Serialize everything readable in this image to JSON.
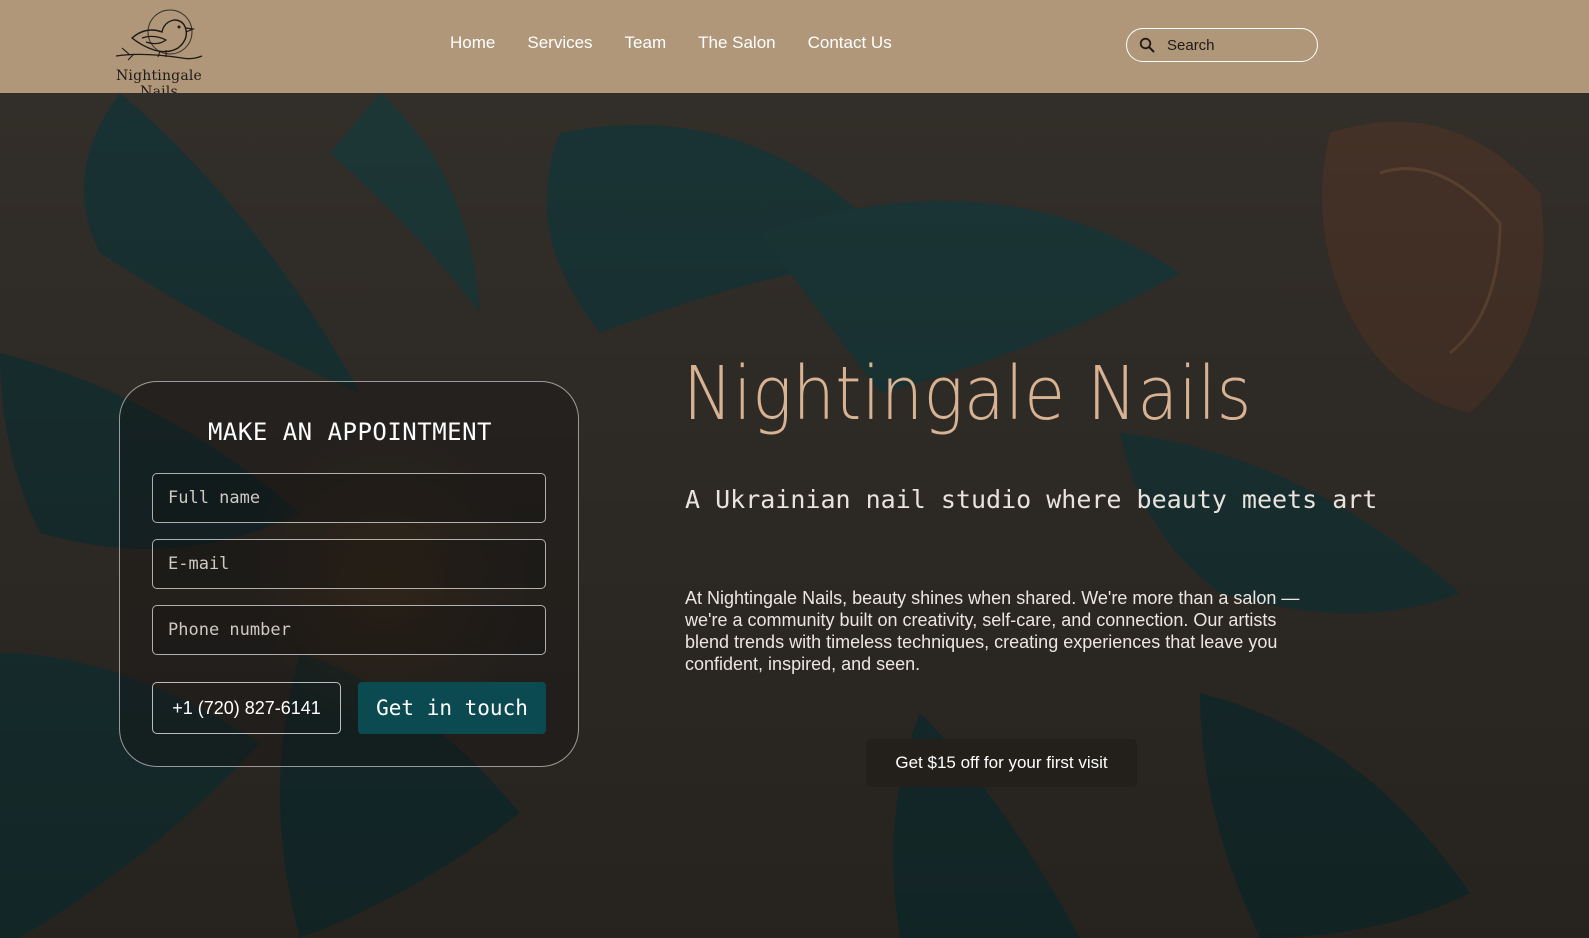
{
  "header": {
    "logo_text": "Nightingale Nails",
    "nav": [
      {
        "label": "Home"
      },
      {
        "label": "Services"
      },
      {
        "label": "Team"
      },
      {
        "label": "The Salon"
      },
      {
        "label": "Contact Us"
      }
    ],
    "search": {
      "placeholder": "Search",
      "icon": "search-icon"
    }
  },
  "appointment": {
    "title": "MAKE AN APPOINTMENT",
    "fields": {
      "full_name": {
        "placeholder": "Full name"
      },
      "email": {
        "placeholder": "E-mail"
      },
      "phone": {
        "placeholder": "Phone number"
      }
    },
    "phone_label": "+1 (720) 827-6141",
    "cta_label": "Get in touch"
  },
  "hero": {
    "title": "Nightingale Nails",
    "tagline": "A Ukrainian nail studio where beauty meets art",
    "description": "At Nightingale Nails, beauty shines when shared. We're more than a salon — we're a community built on creativity, self-care, and connection. Our artists blend trends with timeless techniques, creating experiences that leave you confident, inspired, and seen.",
    "offer_label": "Get $15 off for your first visit"
  },
  "colors": {
    "header_bg": "#b0977a",
    "accent_title": "#d8b393",
    "cta_bg": "#0c4a52",
    "offer_bg": "#231f1b"
  }
}
